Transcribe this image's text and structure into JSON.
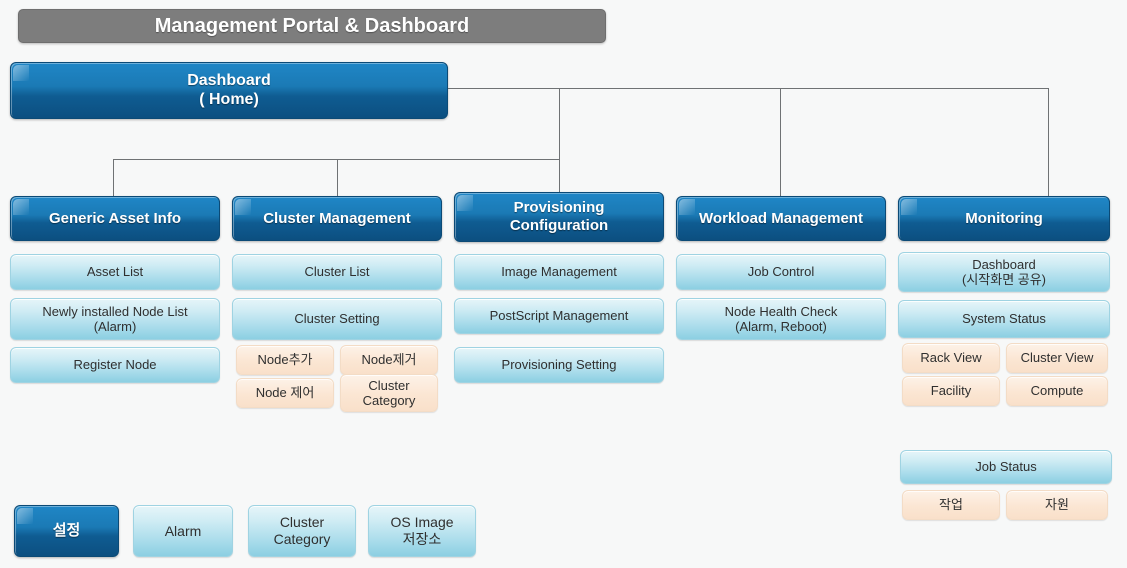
{
  "header": {
    "title": "Management Portal & Dashboard"
  },
  "root": {
    "line1": "Dashboard",
    "line2": "( Home)"
  },
  "columns": [
    {
      "id": "generic-asset-info",
      "title": "Generic Asset Info",
      "items": [
        {
          "label": "Asset List"
        },
        {
          "label": "Newly installed Node List\n(Alarm)"
        },
        {
          "label": "Register Node"
        }
      ],
      "sub_items": []
    },
    {
      "id": "cluster-management",
      "title": "Cluster Management",
      "items": [
        {
          "label": "Cluster List"
        },
        {
          "label": "Cluster Setting"
        }
      ],
      "sub_items": [
        {
          "label": "Node추가"
        },
        {
          "label": "Node제거"
        },
        {
          "label": "Node 제어"
        },
        {
          "label": "Cluster\nCategory"
        }
      ]
    },
    {
      "id": "provisioning-configuration",
      "title": "Provisioning\nConfiguration",
      "items": [
        {
          "label": "Image Management"
        },
        {
          "label": "PostScript Management"
        },
        {
          "label": "Provisioning Setting"
        }
      ],
      "sub_items": []
    },
    {
      "id": "workload-management",
      "title": "Workload Management",
      "items": [
        {
          "label": "Job Control"
        },
        {
          "label": "Node Health Check\n(Alarm, Reboot)"
        }
      ],
      "sub_items": []
    },
    {
      "id": "monitoring",
      "title": "Monitoring",
      "items": [
        {
          "label": "Dashboard\n(시작화면 공유)"
        },
        {
          "label": "System Status"
        }
      ],
      "sub_items": [
        {
          "label": "Rack View"
        },
        {
          "label": "Cluster View"
        },
        {
          "label": "Facility"
        },
        {
          "label": "Compute"
        }
      ],
      "extra_group": {
        "heading": "Job Status",
        "sub_items": [
          {
            "label": "작업"
          },
          {
            "label": "자원"
          }
        ]
      }
    }
  ],
  "footer": [
    {
      "label": "설정",
      "style": "dark"
    },
    {
      "label": "Alarm",
      "style": "light"
    },
    {
      "label": "Cluster\nCategory",
      "style": "light"
    },
    {
      "label": "OS Image\n저장소",
      "style": "light"
    }
  ],
  "colors": {
    "titlebar": "#7d7d7d",
    "header_blue": "#1b7ab5",
    "sub_item_cyan": "#a9dceb",
    "accent_peach": "#fbe6d3",
    "connector": "#6f7274",
    "background": "#f7f8f8"
  }
}
